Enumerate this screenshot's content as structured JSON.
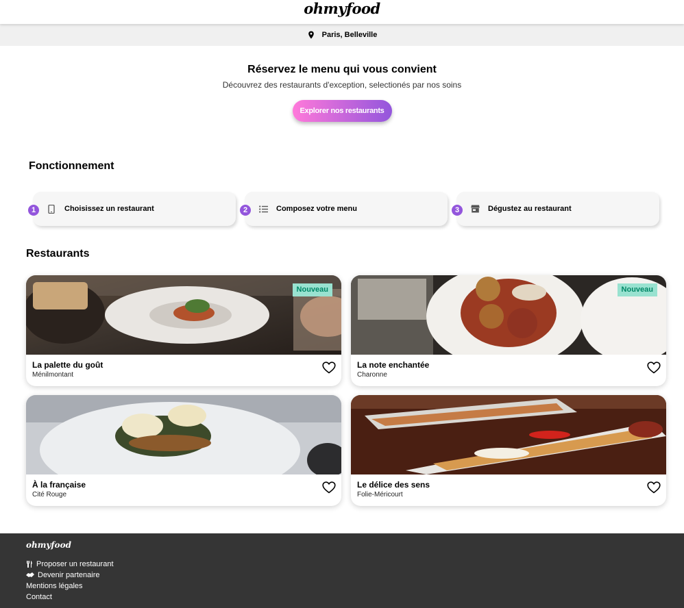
{
  "header": {
    "logo": "ohmyfood"
  },
  "location": {
    "icon": "location-pin-icon",
    "text": "Paris, Belleville"
  },
  "hero": {
    "title": "Réservez le menu qui vous convient",
    "subtitle": "Découvrez des restaurants d'exception, selectionés par nos soins",
    "button": "Explorer nos restaurants"
  },
  "how": {
    "title": "Fonctionnement",
    "steps": [
      {
        "number": "1",
        "icon": "mobile-phone-icon",
        "label": "Choisissez un restaurant"
      },
      {
        "number": "2",
        "icon": "list-icon",
        "label": "Composez votre menu"
      },
      {
        "number": "3",
        "icon": "store-icon",
        "label": "Dégustez au restaurant"
      }
    ]
  },
  "restaurants": {
    "title": "Restaurants",
    "items": [
      {
        "name": "La palette du goût",
        "area": "Ménilmontant",
        "badge": "Nouveau"
      },
      {
        "name": "La note enchantée",
        "area": "Charonne",
        "badge": "Nouveau"
      },
      {
        "name": "À la française",
        "area": "Cité Rouge"
      },
      {
        "name": "Le délice des sens",
        "area": "Folie-Méricourt"
      }
    ]
  },
  "footer": {
    "logo": "ohmyfood",
    "links": [
      {
        "label": "Proposer un restaurant",
        "icon": "utensils-icon"
      },
      {
        "label": "Devenir partenaire",
        "icon": "handshake-icon"
      },
      {
        "label": "Mentions légales"
      },
      {
        "label": "Contact"
      }
    ]
  },
  "colors": {
    "accent": "#9356dc",
    "gradient_start": "#ff79da",
    "badge_bg": "#99e2d0",
    "badge_text": "#008766",
    "footer_bg": "#353535"
  }
}
